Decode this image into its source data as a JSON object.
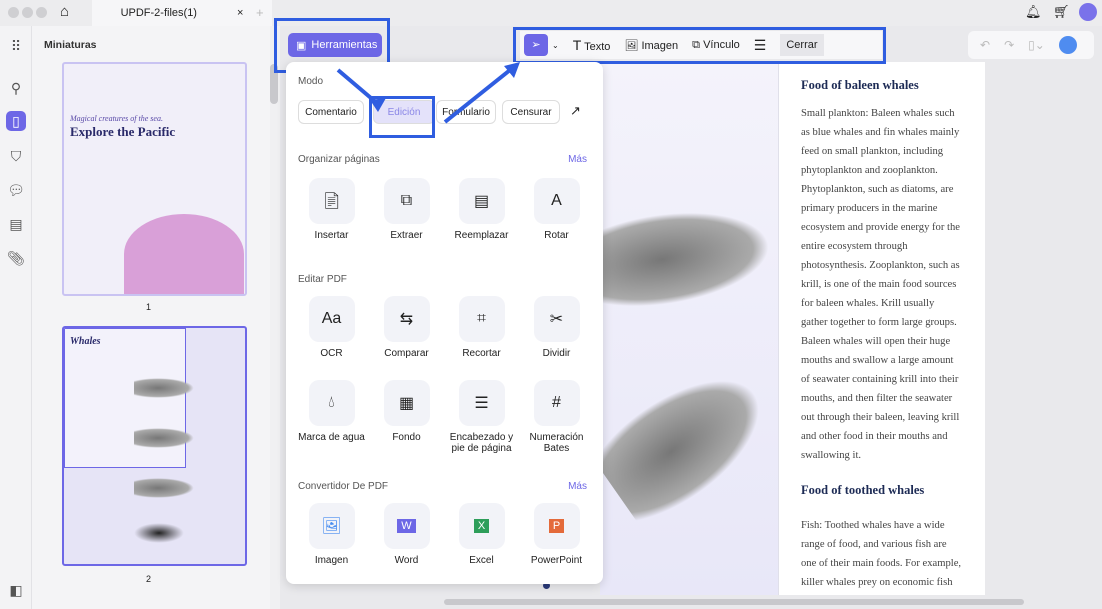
{
  "tab": {
    "title": "UPDF-2-files(1)",
    "close": "×",
    "add": "+"
  },
  "sidebar": {
    "title": "Miniaturas",
    "pages": [
      "1",
      "2"
    ],
    "thumb1": {
      "subtitle": "Magical creatures of the sea.",
      "title": "Explore the Pacific"
    },
    "thumb2": {
      "title": "Whales"
    }
  },
  "toolbar": {
    "tools_button": "Herramientas",
    "text": "Texto",
    "image": "Imagen",
    "link": "Vínculo",
    "close": "Cerrar"
  },
  "popup": {
    "mode_label": "Modo",
    "modes": [
      "Comentario",
      "Edición",
      "Formulario",
      "Censurar"
    ],
    "organize": {
      "label": "Organizar páginas",
      "more": "Más",
      "items": [
        "Insertar",
        "Extraer",
        "Reemplazar",
        "Rotar"
      ]
    },
    "edit": {
      "label": "Editar PDF",
      "items": [
        "OCR",
        "Comparar",
        "Recortar",
        "Dividir",
        "Marca de agua",
        "Fondo",
        "Encabezado y pie de página",
        "Numeración Bates"
      ]
    },
    "convert": {
      "label": "Convertidor De PDF",
      "more": "Más",
      "items": [
        "Imagen",
        "Word",
        "Excel",
        "PowerPoint"
      ]
    }
  },
  "document": {
    "h1": "Food of baleen whales",
    "p1": "Small plankton: Baleen whales such as blue whales and fin whales mainly feed on small plankton, including phytoplankton and zooplankton. Phytoplankton, such as diatoms, are primary producers in the marine ecosystem and provide energy for the entire ecosystem through photosynthesis. Zooplankton, such as krill, is one of the main food sources for baleen whales. Krill usually gather together to form large groups. Baleen whales will open their huge mouths and swallow a large amount of seawater containing krill into their mouths, and then filter the seawater out through their baleen, leaving krill and other food in their mouths and swallowing it.",
    "h2": "Food of toothed whales",
    "p2": "Fish: Toothed whales have a wide range of food, and various fish are one of their main foods. For example, killer whales prey on economic fish"
  }
}
